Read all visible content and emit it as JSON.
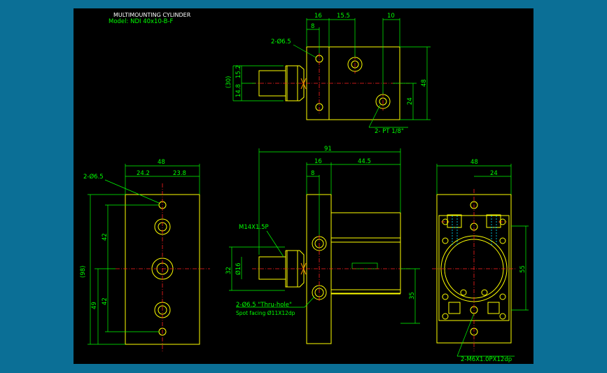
{
  "title": {
    "line1": "MULTIMOUNTING CYLINDER",
    "line2": "Model: NDI 40x10-B-F"
  },
  "top_view": {
    "dims_top": [
      "16",
      "15.5",
      "10"
    ],
    "dim_small": "8",
    "hole_label": "2-Ø6.5",
    "dims_left": [
      "(30)",
      "15.2",
      "14.8"
    ],
    "dims_right": [
      "48",
      "24"
    ],
    "port_label": "2- PT 1/8\""
  },
  "left_view": {
    "hole_label": "2-Ø6.5",
    "dims_top": [
      "48",
      "24.2",
      "23.8"
    ],
    "dims_left": [
      "(98)",
      "49",
      "42",
      "42"
    ]
  },
  "front_view": {
    "dims_top": [
      "91",
      "16",
      "44.5"
    ],
    "dim_small": "8",
    "thread_label": "M14X1.5P",
    "dims_left": [
      "32",
      "Ø16"
    ],
    "dim_right": "35",
    "thru_label": "2-Ø6.5 \"Thru-hole\"",
    "spot_label": "Spot facing Ø11X12dp"
  },
  "right_view": {
    "dims_top": [
      "48",
      "24"
    ],
    "dim_right": "55",
    "tap_label": "2-M6X1.0PX12dp"
  },
  "colors": {
    "background": "#0b6f96",
    "canvas": "#000000",
    "outline": "#ffff00",
    "dimension": "#00ff00",
    "centerline": "#ff2020",
    "hidden": "#00e5ff"
  }
}
